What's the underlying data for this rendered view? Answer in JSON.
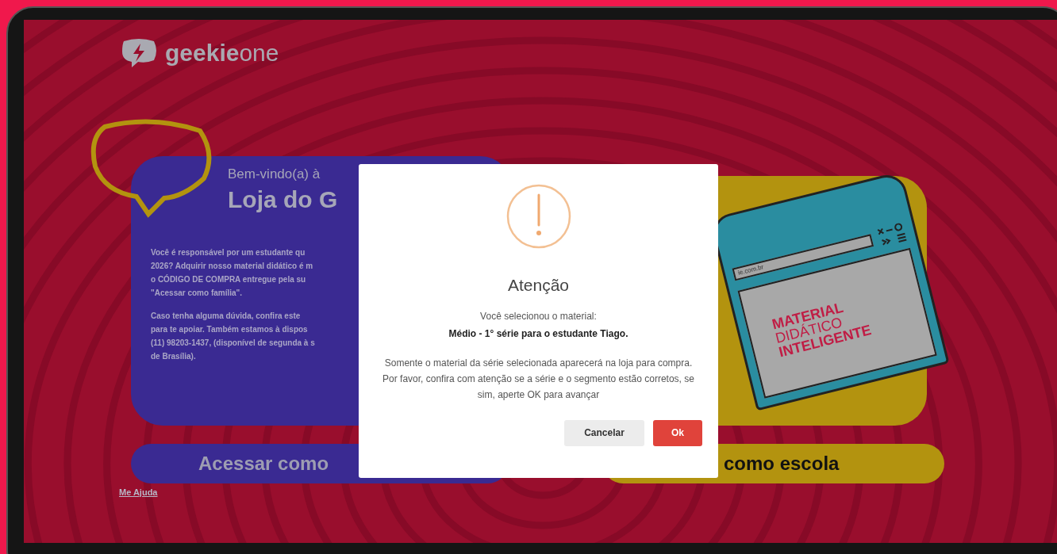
{
  "logo": {
    "brand": "geekie",
    "suffix": "one"
  },
  "welcome": {
    "greeting": "Bem-vindo(a) à",
    "title": "Loja do G",
    "paragraphs": [
      [
        "Você é responsável por um estudante qu",
        "2026? Adquirir nosso material didático é m",
        "o CÓDIGO DE COMPRA entregue pela su",
        "\"Acessar como família\"."
      ],
      [
        "Caso tenha alguma dúvida, confira este",
        "para te apoiar. Também estamos à dispos",
        "(11) 98203-1437, (disponível de segunda à s",
        "de Brasília)."
      ]
    ]
  },
  "illustration": {
    "url": "ie.com.br",
    "lines": [
      "MATERIAL",
      "DIDÁTICO",
      "INTELIGENTE"
    ]
  },
  "family_button": "Acessar como",
  "school_button": "como escola",
  "help_link": "Me Ajuda",
  "modal": {
    "title": "Atenção",
    "intro": "Você selecionou o material:",
    "selection": "Médio - 1° série para o estudante Tiago.",
    "notes": [
      "Somente o material da série selecionada aparecerá na loja para compra.",
      "Por favor, confira com atenção se a série e o segmento estão corretos, se sim, aperte OK para avançar"
    ],
    "buttons": [
      {
        "label": "Cancelar",
        "kind": "secondary"
      },
      {
        "label": "Ok",
        "kind": "primary"
      }
    ]
  }
}
